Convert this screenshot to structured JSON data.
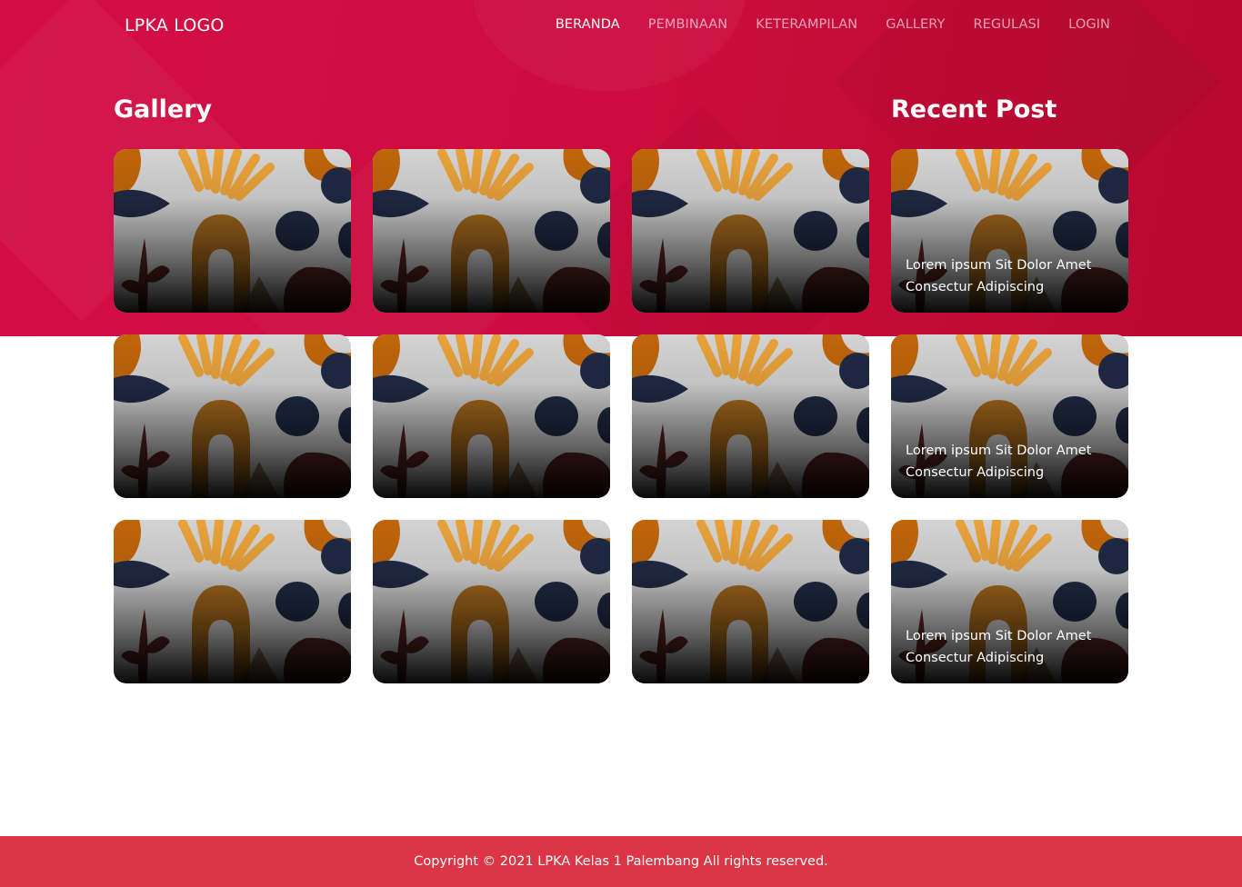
{
  "brand": {
    "logo": "LPKA LOGO"
  },
  "nav": {
    "items": [
      {
        "label": "BERANDA",
        "active": true
      },
      {
        "label": "PEMBINAAN",
        "active": false
      },
      {
        "label": "KETERAMPILAN",
        "active": false
      },
      {
        "label": "GALLERY",
        "active": false
      },
      {
        "label": "REGULASI",
        "active": false
      },
      {
        "label": "LOGIN",
        "active": false
      }
    ]
  },
  "gallery": {
    "title": "Gallery",
    "rows": 3,
    "columns": 3,
    "thumbnail_art": "abstract-shapes-illustration"
  },
  "recent": {
    "title": "Recent Post",
    "posts": [
      {
        "caption": "Lorem ipsum Sit Dolor Amet Consectur Adipiscing"
      },
      {
        "caption": "Lorem ipsum Sit Dolor Amet Consectur Adipiscing"
      },
      {
        "caption": "Lorem ipsum Sit Dolor Amet Consectur Adipiscing"
      }
    ]
  },
  "footer": {
    "copyright": "Copyright © 2021 LPKA Kelas 1 Palembang All rights reserved."
  },
  "colors": {
    "hero_red": "#cc0c3e",
    "footer_red": "#dc3545",
    "text_white": "#ffffff",
    "art_orange": "#c0650a",
    "art_ray": "#e9a23b",
    "art_navy": "#1f2a44",
    "art_arch": "#a86a1c",
    "art_plum": "#5a2420"
  }
}
